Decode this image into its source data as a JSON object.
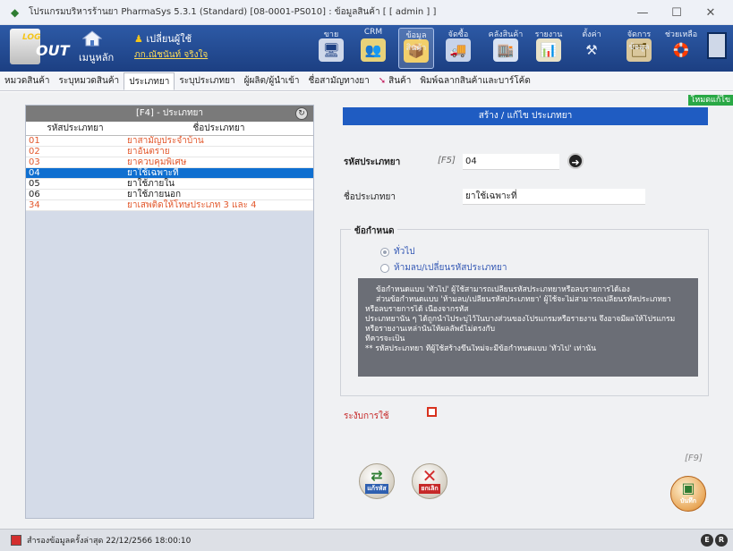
{
  "window": {
    "title": "โปรแกรมบริหารร้านยา PharmaSys 5.3.1 (Standard) [08-0001-PS010] : ข้อมูลสินค้า [ [ admin ] ]",
    "minimize": "—",
    "maximize": "☐",
    "close": "✕"
  },
  "ribbon": {
    "logout_top": "LOG",
    "logout_bottom": "OUT",
    "home_label": "เมนูหลัก",
    "switch_user": "เปลี่ยนผู้ใช้",
    "user_name": "ภก.ณัชนันท์ จริงใจ",
    "tools": [
      {
        "label": "ขาย",
        "icon": "🖥"
      },
      {
        "label": "CRM",
        "icon": "👥"
      },
      {
        "label": "ข้อมูลสินค้า",
        "icon": "📦"
      },
      {
        "label": "จัดซื้อ",
        "icon": "🚚"
      },
      {
        "label": "คลังสินค้า",
        "icon": "🏬"
      },
      {
        "label": "รายงาน",
        "icon": "📊"
      },
      {
        "label": "ตั้งค่า",
        "icon": "⚒"
      },
      {
        "label": "จัดการข้อมูล",
        "icon": "🗂"
      },
      {
        "label": "ช่วยเหลือ",
        "icon": "🛟"
      }
    ]
  },
  "tabs": [
    {
      "label": "หมวดสินค้า"
    },
    {
      "label": "ระบุหมวดสินค้า"
    },
    {
      "label": "ประเภทยา"
    },
    {
      "label": "ระบุประเภทยา"
    },
    {
      "label": "ผู้ผลิต/ผู้นำเข้า"
    },
    {
      "label": "ชื่อสามัญทางยา"
    },
    {
      "label": "สินค้า"
    },
    {
      "label": "พิมพ์ฉลากสินค้าและบาร์โค้ด"
    }
  ],
  "mode_badge": "โหมดแก้ไข",
  "list": {
    "title": "[F4] - ประเภทยา",
    "col_code": "รหัสประเภทยา",
    "col_name": "ชื่อประเภทยา",
    "rows": [
      {
        "code": "01",
        "name": "ยาสามัญประจำบ้าน"
      },
      {
        "code": "02",
        "name": "ยาอันตราย"
      },
      {
        "code": "03",
        "name": "ยาควบคุมพิเศษ"
      },
      {
        "code": "04",
        "name": "ยาใช้เฉพาะที่"
      },
      {
        "code": "05",
        "name": "ยาใช้ภายใน"
      },
      {
        "code": "06",
        "name": "ยาใช้ภายนอก"
      },
      {
        "code": "34",
        "name": "ยาเสพติดให้โทษประเภท 3 และ 4"
      }
    ]
  },
  "form": {
    "header": "สร้าง / แก้ไข ประเภทยา",
    "code_label": "รหัสประเภทยา",
    "code_hotkey": "[F5]",
    "code_value": "04",
    "name_label": "ชื่อประเภทยา",
    "name_value": "ยาใช้เฉพาะที่",
    "condition_title": "ข้อกำหนด",
    "option_general": "ทั่วไป",
    "option_locked": "ห้ามลบ/เปลี่ยนรหัสประเภทยา",
    "note_lines": [
      "ข้อกำหนดแบบ 'ทั่วไป' ผู้ใช้สามารถเปลี่ยนรหัสประเภทยาหรือลบรายการได้เอง",
      "ส่วนข้อกำหนดแบบ 'ห้ามลบ/เปลี่ยนรหัสประเภทยา' ผู้ใช้จะไม่สามารถเปลี่ยนรหัสประเภทยา",
      "หรือลบรายการได้ เนื่องจากรหัส",
      "ประเภทยานั้น ๆ ได้ถูกนำไประบุไว้ในบางส่วนของโปรแกรมหรือรายงาน จึงอาจมีผลให้โปรแกรม",
      "หรือรายงานเหล่านั้นให้ผลลัพธ์ไม่ตรงกับ",
      "ที่ควรจะเป็น",
      "** รหัสประเภทยา ที่ผู้ใช้สร้างขึ้นใหม่จะมีข้อกำหนดแบบ 'ทั่วไป' เท่านั้น"
    ],
    "suspend_label": "ระงับการใช้",
    "btn_change_code": "แก้รหัส",
    "btn_cancel": "ยกเลิก",
    "btn_save": "บันทึก",
    "save_hotkey": "[F9]"
  },
  "status": {
    "text": "สำรองข้อมูลครั้งล่าสุด  22/12/2566 18:00:10",
    "badge_e": "E",
    "badge_r": "R"
  },
  "colors": {
    "ribbon": "#1c3f82",
    "header_blue": "#1f5cc2",
    "selected_row": "#0f6fd0",
    "red_text": "#e2572b",
    "mode_green": "#29a845"
  }
}
